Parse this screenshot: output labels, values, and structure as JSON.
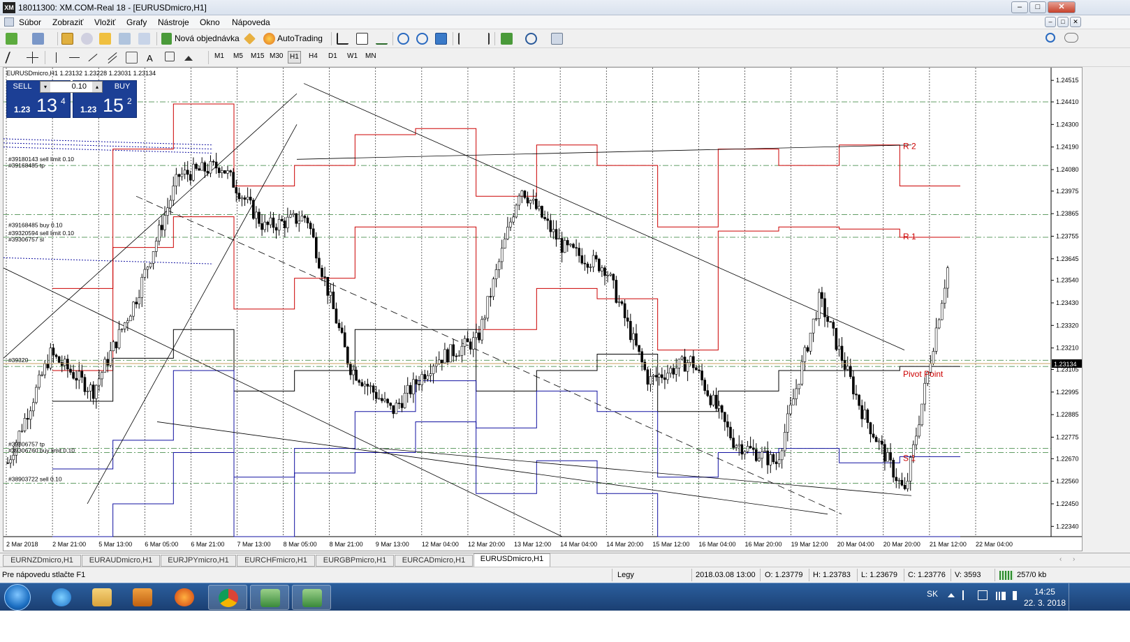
{
  "window": {
    "title": "18011300: XM.COM-Real 18 - [EURUSDmicro,H1]",
    "logo": "XM",
    "buttons": [
      "–",
      "□",
      "✕"
    ]
  },
  "menu": {
    "items": [
      "Súbor",
      "Zobraziť",
      "Vložiť",
      "Grafy",
      "Nástroje",
      "Okno",
      "Nápoveda"
    ]
  },
  "toolbar1": {
    "new_order": "Nová objednávka",
    "autotrading": "AutoTrading"
  },
  "toolbar2": {
    "timeframes": [
      "M1",
      "M5",
      "M15",
      "M30",
      "H1",
      "H4",
      "D1",
      "W1",
      "MN"
    ],
    "active_timeframe": "H1",
    "text_tool": "A"
  },
  "chart": {
    "symbol_label": "EURUSDmicro,H1  1.23132 1.23228 1.23031 1.23134",
    "one_click": {
      "sell_label": "SELL",
      "buy_label": "BUY",
      "volume": "0.10",
      "sell_price_small": "1.23",
      "sell_price_big": "13",
      "sell_price_sup": "4",
      "buy_price_small": "1.23",
      "buy_price_big": "15",
      "buy_price_sup": "2"
    },
    "pivot_labels": {
      "r2": "R 2",
      "r1": "R 1",
      "pp": "Pivot Point",
      "s1": "S 1"
    },
    "order_labels": [
      "#39180143 sell limit 0.10",
      "#39168485 tp",
      "#39168485 buy 0.10",
      "#39320594 sell limit 0.10",
      "#39306757 sl",
      "#39320",
      "#39306757 tp",
      "#39306760 buy limit 0.10",
      "#38903722 sell 0.10"
    ],
    "current_price": "1.23134",
    "colors": {
      "up": "#cc0000",
      "down": "#1010a0",
      "neutral": "#000000",
      "grid_green": "#2e7d32",
      "price_tag": "#000000"
    }
  },
  "chart_data": {
    "type": "line",
    "title": "",
    "xlabel": "",
    "ylabel": "",
    "y_ticks": [
      "1.24515",
      "1.24410",
      "1.24300",
      "1.24190",
      "1.24080",
      "1.23975",
      "1.23865",
      "1.23755",
      "1.23645",
      "1.23540",
      "1.23430",
      "1.23320",
      "1.23210",
      "1.23105",
      "1.22995",
      "1.22885",
      "1.22775",
      "1.22670",
      "1.22560",
      "1.22450",
      "1.22340"
    ],
    "x_ticks": [
      "2 Mar 2018",
      "2 Mar 21:00",
      "5 Mar 13:00",
      "6 Mar 05:00",
      "6 Mar 21:00",
      "7 Mar 13:00",
      "8 Mar 05:00",
      "8 Mar 21:00",
      "9 Mar 13:00",
      "12 Mar 04:00",
      "12 Mar 20:00",
      "13 Mar 12:00",
      "14 Mar 04:00",
      "14 Mar 20:00",
      "15 Mar 12:00",
      "16 Mar 04:00",
      "16 Mar 20:00",
      "19 Mar 12:00",
      "20 Mar 04:00",
      "20 Mar 20:00",
      "21 Mar 12:00",
      "22 Mar 04:00"
    ],
    "ylim": [
      1.2229,
      1.2457
    ],
    "series": [
      {
        "name": "",
        "x": [
          0,
          1,
          2,
          3,
          4,
          5,
          6,
          7,
          8,
          9,
          10,
          11,
          12,
          13,
          14,
          15,
          16,
          17,
          18,
          19,
          20,
          21,
          22
        ],
        "values": [
          1.2265,
          1.2318,
          1.23,
          1.2345,
          1.2405,
          1.241,
          1.238,
          1.2385,
          1.2312,
          1.229,
          1.2315,
          1.2325,
          1.24,
          1.237,
          1.236,
          1.2305,
          1.2315,
          1.2275,
          1.2265,
          1.2345,
          1.229,
          1.225,
          1.236
        ]
      }
    ]
  },
  "tabs": {
    "items": [
      "EURNZDmicro,H1",
      "EURAUDmicro,H1",
      "EURJPYmicro,H1",
      "EURCHFmicro,H1",
      "EURGBPmicro,H1",
      "EURCADmicro,H1",
      "EURUSDmicro,H1"
    ],
    "active": "EURUSDmicro,H1"
  },
  "status": {
    "help": "Pre nápovedu stlačte F1",
    "profile": "Legy",
    "datetime": "2018.03.08 13:00",
    "open": "O: 1.23779",
    "high": "H: 1.23783",
    "low": "L: 1.23679",
    "close": "C: 1.23776",
    "volume": "V: 3593",
    "traffic": "257/0 kb"
  },
  "taskbar": {
    "lang": "SK",
    "time": "14:25",
    "date": "22. 3. 2018"
  }
}
